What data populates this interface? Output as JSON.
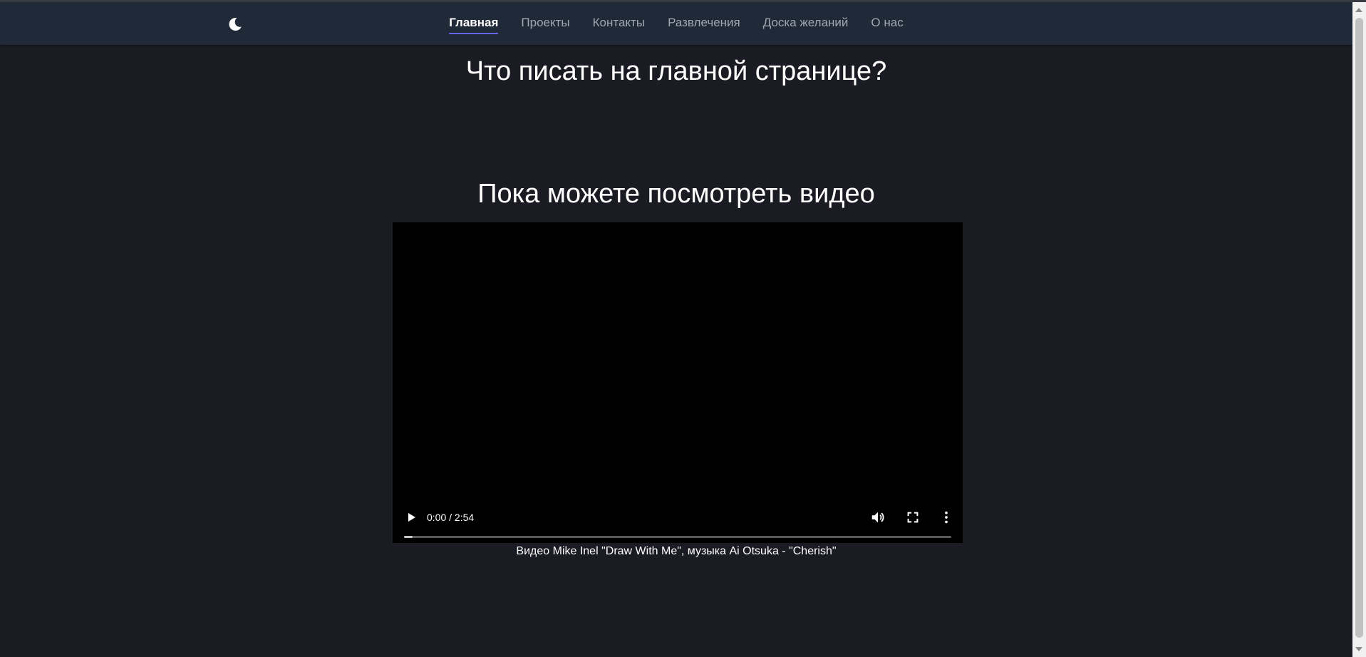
{
  "nav": {
    "theme_toggle_icon": "moon-icon",
    "items": [
      {
        "label": "Главная",
        "active": true
      },
      {
        "label": "Проекты",
        "active": false
      },
      {
        "label": "Контакты",
        "active": false
      },
      {
        "label": "Развлечения",
        "active": false
      },
      {
        "label": "Доска желаний",
        "active": false
      },
      {
        "label": "О нас",
        "active": false
      }
    ]
  },
  "main": {
    "title": "Что писать на главной странице?",
    "video_heading": "Пока можете посмотреть видео",
    "video": {
      "time_display": "0:00 / 2:54",
      "progress": 0.0,
      "play_icon": "play-icon",
      "volume_icon": "volume-icon",
      "fullscreen_icon": "fullscreen-icon",
      "more_icon": "more-vertical-icon"
    },
    "caption": "Видео Mike Inel \"Draw With Me\", музыка Ai Otsuka - \"Cherish\""
  },
  "colors": {
    "background": "#1a1b23",
    "navbar": "#1f2937",
    "nav_active": "#ffffff",
    "nav_inactive": "#a1a7b3",
    "nav_underline": "#6366f1",
    "video_bg": "#000000"
  }
}
